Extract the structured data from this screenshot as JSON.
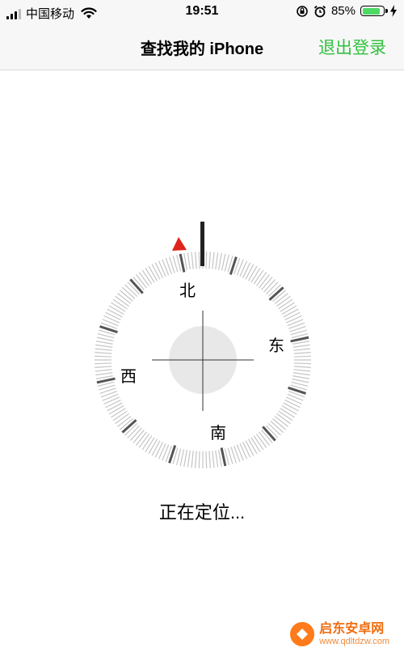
{
  "status_bar": {
    "carrier": "中国移动",
    "time": "19:51",
    "battery_percent": "85%",
    "battery_level": 0.85,
    "icons": [
      "signal-bars-icon",
      "wifi-icon",
      "rotation-lock-icon",
      "alarm-icon",
      "battery-icon",
      "charging-bolt-icon"
    ]
  },
  "nav": {
    "title": "查找我的 iPhone",
    "action_label": "退出登录",
    "action_color": "#32c13e"
  },
  "compass": {
    "north": "北",
    "east": "东",
    "south": "南",
    "west": "西",
    "indicator_color": "#e0241b"
  },
  "status_text": "正在定位...",
  "watermark": {
    "name": "启东安卓网",
    "url": "www.qdltdzw.com",
    "accent": "#ff7a1a"
  }
}
